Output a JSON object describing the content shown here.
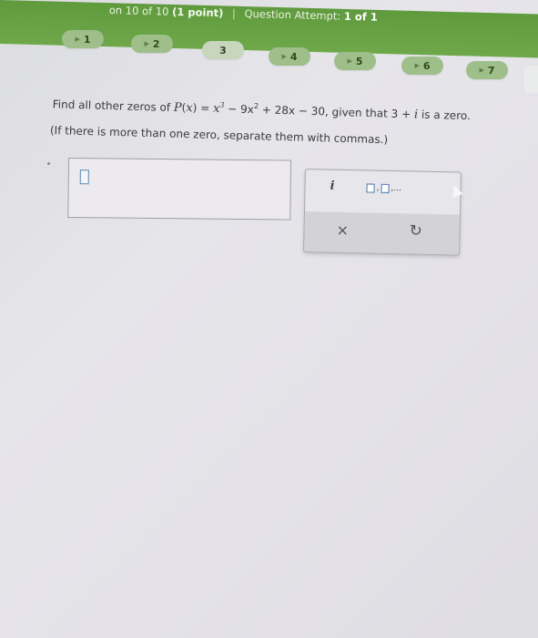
{
  "header": {
    "progress": "on 10 of 10",
    "points": "(1 point)",
    "separator": "|",
    "attempt_label": "Question Attempt:",
    "attempt_value": "1 of 1"
  },
  "question_nav": {
    "items": [
      {
        "label": "1",
        "state": "answered"
      },
      {
        "label": "2",
        "state": "answered"
      },
      {
        "label": "3",
        "state": "current"
      },
      {
        "label": "4",
        "state": "answered"
      },
      {
        "label": "5",
        "state": "answered"
      },
      {
        "label": "6",
        "state": "answered"
      },
      {
        "label": "7",
        "state": "answered"
      }
    ],
    "flag_icon": "flag-icon"
  },
  "question": {
    "prefix": "Find all other zeros of",
    "func": "P",
    "var": "x",
    "eq": " = ",
    "t1_base": "x",
    "t1_exp": "3",
    "op1": " − ",
    "t2_base": "9x",
    "t2_exp": "2",
    "op2": " + ",
    "t3": "28x",
    "op3": " − ",
    "t4": "30",
    "given_prefix": ", given that ",
    "given_real": "3",
    "given_op": " + ",
    "given_imag": "i",
    "given_suffix": " is a zero.",
    "instruction": "(If there is more than one zero, separate them with commas.)"
  },
  "answer": {
    "value": ""
  },
  "keypad": {
    "imaginary_unit": "i",
    "list_comma": ",...",
    "clear_symbol": "×",
    "undo_symbol": "↻"
  },
  "colors": {
    "header_green": "#6aa343",
    "nav_button": "#9fbf8a",
    "answer_cursor": "#5b88b0"
  }
}
